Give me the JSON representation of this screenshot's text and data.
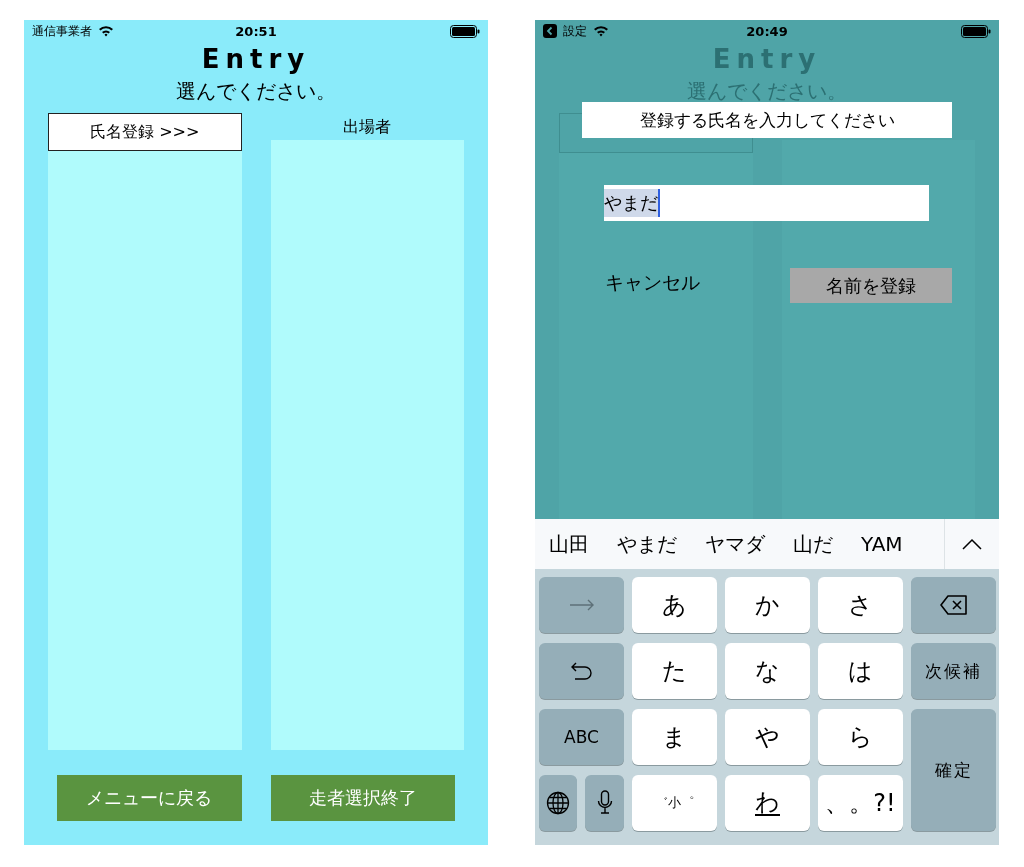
{
  "entry_screen": {
    "status_bar": {
      "carrier": "通信事業者",
      "time": "20:51"
    },
    "title": "Entry",
    "prompt": "選んでください。",
    "register_button": "氏名登録 >>>",
    "entrants_label": "出場者",
    "buttons": [
      "メニューに戻る",
      "走者選択終了"
    ]
  },
  "dialog_screen": {
    "status_bar": {
      "back_label": "設定",
      "time": "20:49"
    },
    "background": {
      "title": "Entry",
      "prompt": "選んでください。"
    },
    "dialog": {
      "title": "登録する氏名を入力してください",
      "field": {
        "value": "やまだ"
      },
      "cancel": "キャンセル",
      "confirm": "名前を登録"
    },
    "keyboard": {
      "candidates": [
        "山田",
        "やまだ",
        "ヤマダ",
        "山だ",
        "YAM"
      ],
      "keys": [
        {
          "kind": "arrow"
        },
        {
          "kind": "kana",
          "label": "あ"
        },
        {
          "kind": "kana",
          "label": "か"
        },
        {
          "kind": "kana",
          "label": "さ"
        },
        {
          "kind": "delete"
        },
        {
          "kind": "undo"
        },
        {
          "kind": "kana",
          "label": "た"
        },
        {
          "kind": "kana",
          "label": "な"
        },
        {
          "kind": "kana",
          "label": "は"
        },
        {
          "kind": "function",
          "label": "次候補"
        },
        {
          "kind": "mode",
          "label": "ABC"
        },
        {
          "kind": "kana",
          "label": "ま"
        },
        {
          "kind": "kana",
          "label": "や"
        },
        {
          "kind": "kana",
          "label": "ら"
        },
        {
          "kind": "confirm",
          "label": "確定"
        },
        {
          "kind": "globe"
        },
        {
          "kind": "mic"
        },
        {
          "kind": "modifier",
          "label": "゛小゜"
        },
        {
          "kind": "kana_bar",
          "label": "わ"
        },
        {
          "kind": "kana",
          "label": "、。?!"
        }
      ]
    }
  }
}
